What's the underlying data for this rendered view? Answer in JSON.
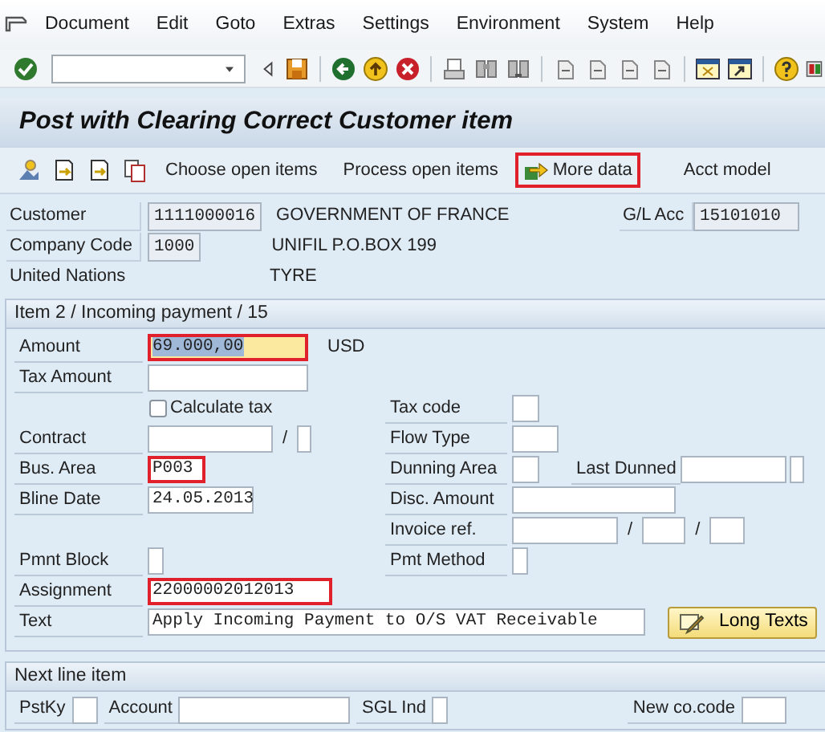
{
  "menu": [
    {
      "label": "Document"
    },
    {
      "label": "Edit"
    },
    {
      "label": "Goto"
    },
    {
      "label": "Extras"
    },
    {
      "label": "Settings"
    },
    {
      "label": "Environment"
    },
    {
      "label": "System"
    },
    {
      "label": "Help"
    }
  ],
  "title": "Post with Clearing Correct Customer item",
  "app_toolbar": {
    "buttons": [
      {
        "label": "Choose open items",
        "highlighted": false
      },
      {
        "label": "Process open items",
        "highlighted": false
      },
      {
        "label": "More data",
        "highlighted": true,
        "kind": "icon"
      },
      {
        "label": "Acct model",
        "highlighted": false
      }
    ]
  },
  "header": {
    "customer": {
      "label": "Customer",
      "value": "1111000016",
      "name": "GOVERNMENT OF FRANCE"
    },
    "gl_account": {
      "label": "G/L Acc",
      "value": "15101010"
    },
    "company_code": {
      "label": "Company Code",
      "value": "1000",
      "address": "UNIFIL P.O.BOX 199"
    },
    "company_name": "United Nations",
    "city": "TYRE"
  },
  "item_group": {
    "title": "Item 2 / Incoming payment / 15",
    "rows": [
      {
        "left": [
          {
            "kind": "label",
            "text": "Amount"
          },
          {
            "kind": "field",
            "value": "69.000,00",
            "focused": true,
            "highlighted": true
          },
          {
            "kind": "unit",
            "text": "USD"
          }
        ],
        "right": []
      },
      {
        "left": [
          {
            "kind": "label",
            "text": "Tax Amount"
          },
          {
            "kind": "field"
          }
        ],
        "right": []
      },
      {
        "left": [
          {
            "kind": "checkbox",
            "text": "Calculate tax",
            "checked": false
          }
        ],
        "right": [
          {
            "kind": "label",
            "text": "Tax code"
          },
          {
            "kind": "field"
          }
        ]
      },
      {
        "left": [
          {
            "kind": "label",
            "text": "Contract"
          },
          {
            "kind": "field"
          },
          {
            "kind": "sep",
            "text": "/"
          },
          {
            "kind": "field"
          }
        ],
        "right": [
          {
            "kind": "label",
            "text": "Flow Type"
          },
          {
            "kind": "field"
          }
        ]
      },
      {
        "left": [
          {
            "kind": "label",
            "text": "Bus. Area"
          },
          {
            "kind": "field",
            "value": "P003",
            "highlighted": true
          }
        ],
        "right": [
          {
            "kind": "label",
            "text": "Dunning Area"
          },
          {
            "kind": "field"
          },
          {
            "kind": "label",
            "text": "Last Dunned"
          },
          {
            "kind": "field"
          },
          {
            "kind": "field"
          }
        ]
      },
      {
        "left": [
          {
            "kind": "label",
            "text": "Bline Date"
          },
          {
            "kind": "field",
            "value": "24.05.2013"
          }
        ],
        "right": [
          {
            "kind": "label",
            "text": "Disc. Amount"
          },
          {
            "kind": "field"
          }
        ]
      },
      {
        "left": [],
        "right": [
          {
            "kind": "label",
            "text": "Invoice ref."
          },
          {
            "kind": "field"
          },
          {
            "kind": "sep",
            "text": "/"
          },
          {
            "kind": "field"
          },
          {
            "kind": "sep",
            "text": "/"
          },
          {
            "kind": "field"
          }
        ]
      },
      {
        "left": [
          {
            "kind": "label",
            "text": "Pmnt Block"
          },
          {
            "kind": "field"
          }
        ],
        "right": [
          {
            "kind": "label",
            "text": "Pmt Method"
          },
          {
            "kind": "field"
          }
        ]
      },
      {
        "left": [
          {
            "kind": "label",
            "text": "Assignment"
          },
          {
            "kind": "field",
            "value": "22000002012013",
            "highlighted": true
          }
        ],
        "right": []
      },
      {
        "left": [
          {
            "kind": "label",
            "text": "Text"
          },
          {
            "kind": "field",
            "value": "Apply Incoming Payment to O/S VAT Receivable"
          },
          {
            "kind": "button",
            "text": "Long Texts"
          }
        ],
        "right": []
      }
    ]
  },
  "next_group": {
    "title": "Next line item",
    "items": [
      {
        "kind": "label",
        "text": "PstKy"
      },
      {
        "kind": "field"
      },
      {
        "kind": "label",
        "text": "Account"
      },
      {
        "kind": "field"
      },
      {
        "kind": "label",
        "text": "SGL Ind"
      },
      {
        "kind": "field"
      },
      {
        "kind": "label",
        "text": "New co.code"
      },
      {
        "kind": "field"
      }
    ]
  }
}
